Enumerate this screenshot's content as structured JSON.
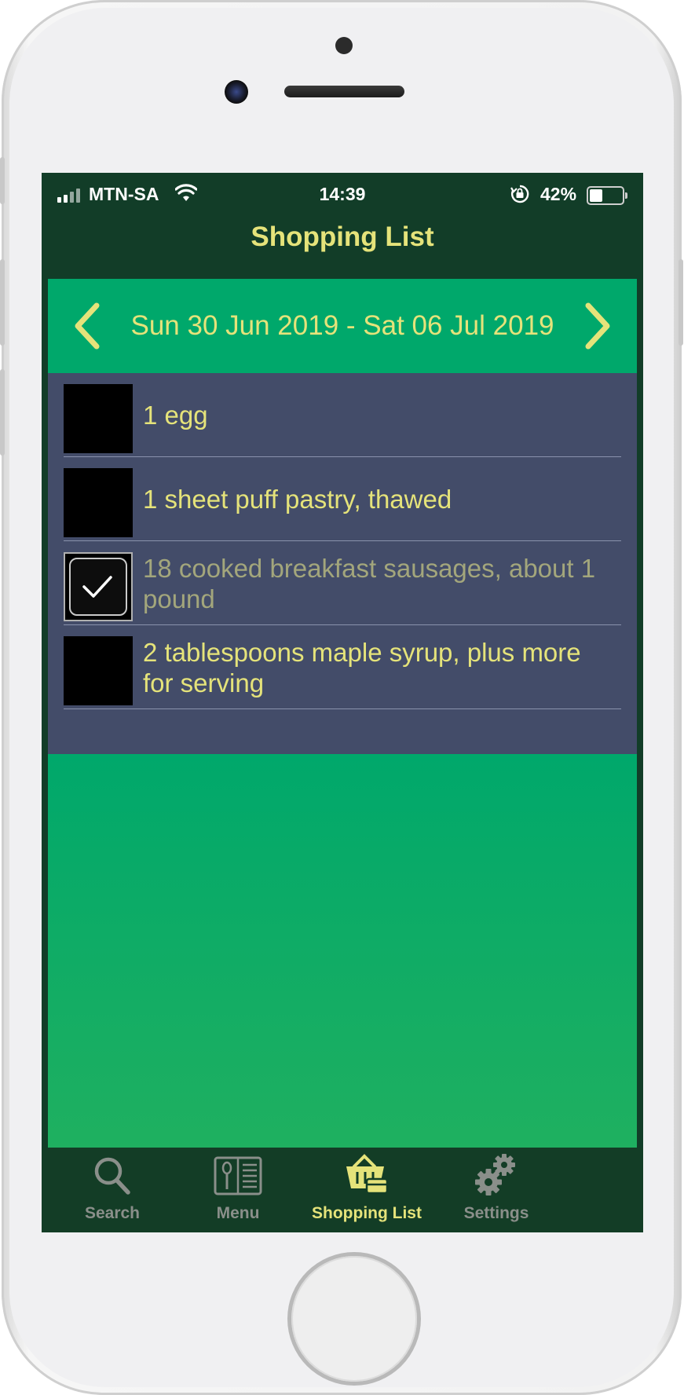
{
  "status_bar": {
    "carrier": "MTN-SA",
    "time": "14:39",
    "battery": "42%",
    "battery_level": 0.42
  },
  "nav": {
    "title": "Shopping List"
  },
  "week": {
    "label": "Sun 30 Jun 2019 - Sat 06 Jul 2019"
  },
  "items": [
    {
      "text": "1 egg",
      "checked": false
    },
    {
      "text": "1 sheet puff pastry, thawed",
      "checked": false
    },
    {
      "text": "18 cooked breakfast sausages, about 1 pound",
      "checked": true
    },
    {
      "text": "2 tablespoons maple syrup, plus more for serving",
      "checked": false
    }
  ],
  "tabs": [
    {
      "label": "Search",
      "icon": "search-icon",
      "active": false
    },
    {
      "label": "Menu",
      "icon": "menu-book-icon",
      "active": false
    },
    {
      "label": "Shopping List",
      "icon": "shopping-basket-icon",
      "active": true
    },
    {
      "label": "Settings",
      "icon": "gears-icon",
      "active": false
    }
  ],
  "colors": {
    "nav_background": "#123d28",
    "accent_green": "#00a86b",
    "list_background": "#434c69",
    "text_yellow": "#e5e37a",
    "inactive_tab": "#8a8f8a"
  }
}
